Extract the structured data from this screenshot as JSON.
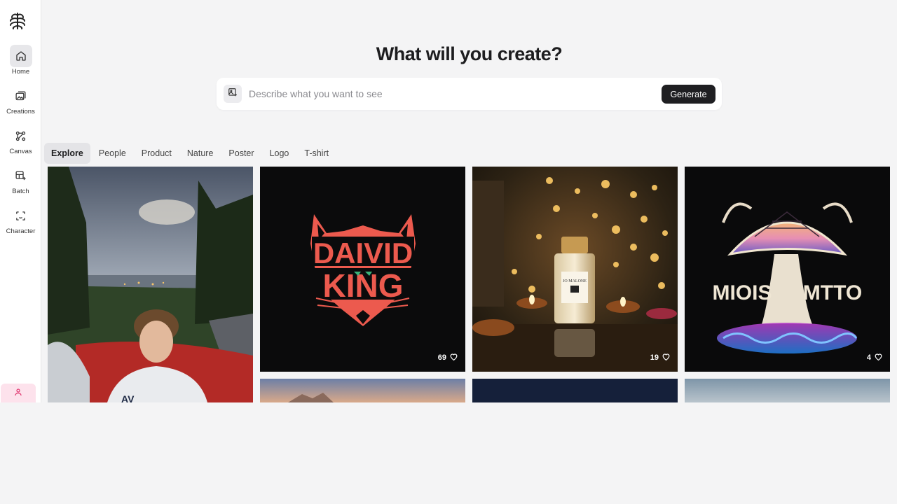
{
  "sidebar": {
    "items": [
      {
        "label": "Home",
        "icon": "home-icon"
      },
      {
        "label": "Creations",
        "icon": "image-gallery-icon"
      },
      {
        "label": "Canvas",
        "icon": "canvas-nodes-icon"
      },
      {
        "label": "Batch",
        "icon": "batch-grid-icon"
      },
      {
        "label": "Character",
        "icon": "character-frame-icon"
      }
    ],
    "profile_icon": "user-icon"
  },
  "main": {
    "title": "What will you create?",
    "prompt": {
      "placeholder": "Describe what you want to see",
      "value": ""
    },
    "generate_label": "Generate",
    "tabs": [
      "Explore",
      "People",
      "Product",
      "Nature",
      "Poster",
      "Logo",
      "T-shirt"
    ],
    "active_tab": "Explore"
  },
  "gallery": {
    "cards": [
      {
        "subject": "portrait",
        "likes": ""
      },
      {
        "subject": "logo-david-king",
        "logo_line1": "DAIVID",
        "logo_line2": "KING",
        "likes": "69"
      },
      {
        "subject": "perfume",
        "bottle_text": "JO MALONE",
        "likes": "19"
      },
      {
        "subject": "mushroom-tshirt",
        "logo_text_left": "MIOIS",
        "logo_text_right": "MTTO",
        "likes": "4"
      }
    ]
  },
  "colors": {
    "accent": "#1f1f22",
    "background": "#f4f4f5",
    "logo_red": "#ec5a4e",
    "profile_pink": "#fde2ec"
  }
}
